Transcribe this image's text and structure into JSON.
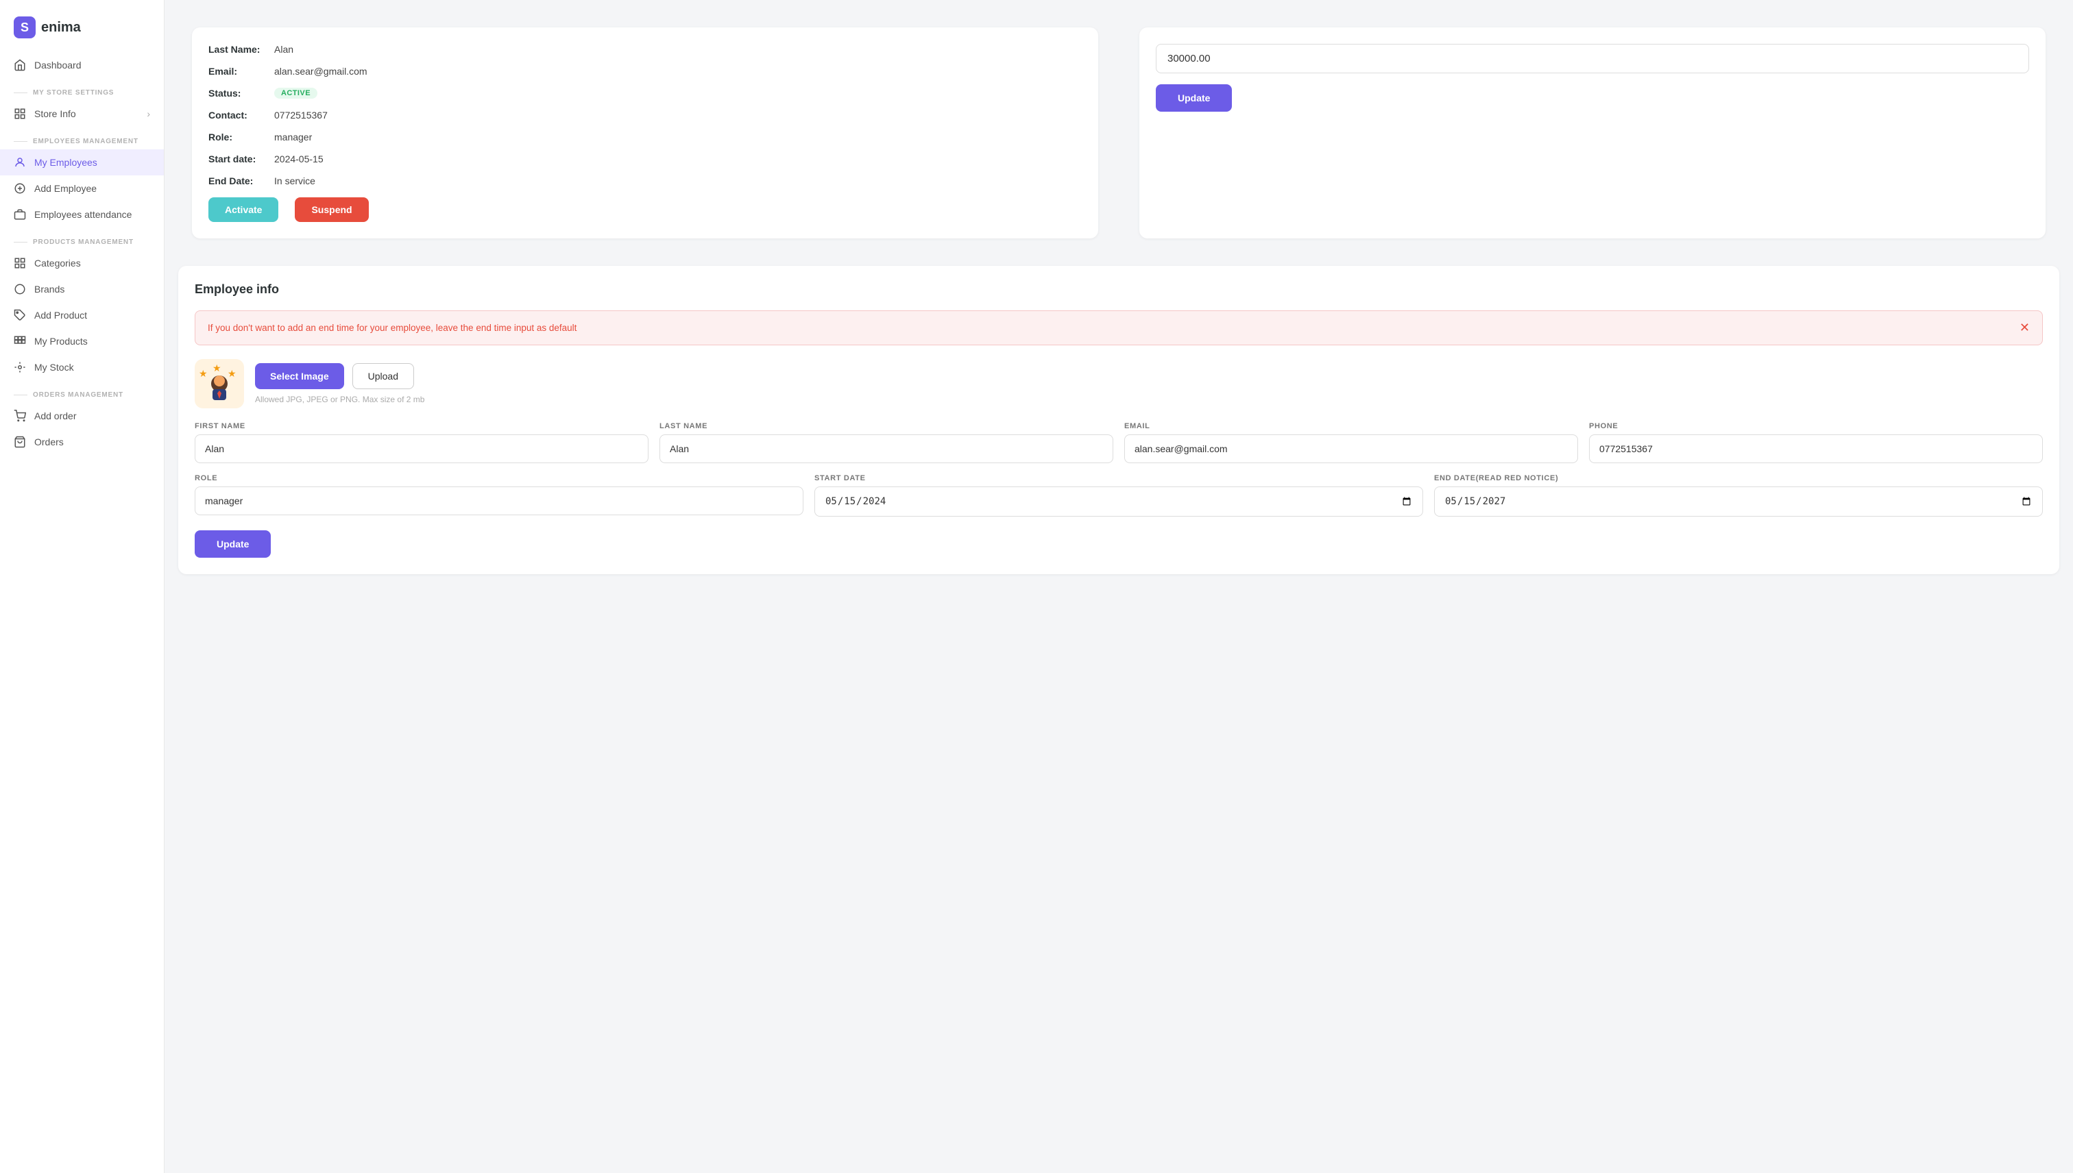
{
  "app": {
    "name": "enima",
    "logo_symbol": "S"
  },
  "sidebar": {
    "items": [
      {
        "id": "dashboard",
        "label": "Dashboard",
        "icon": "home-icon",
        "section": null
      },
      {
        "id": "store-info",
        "label": "Store Info",
        "icon": "store-icon",
        "section": "MY STORE SETTINGS",
        "has_arrow": true
      },
      {
        "id": "my-employees",
        "label": "My Employees",
        "icon": "person-icon",
        "section": "EMPLOYEES MANAGEMENT",
        "active": true
      },
      {
        "id": "add-employee",
        "label": "Add Employee",
        "icon": "add-circle-icon",
        "section": null
      },
      {
        "id": "employees-attendance",
        "label": "Employees attendance",
        "icon": "briefcase-icon",
        "section": null
      },
      {
        "id": "categories",
        "label": "Categories",
        "icon": "grid-icon",
        "section": "PRODUCTS MANAGEMENT"
      },
      {
        "id": "brands",
        "label": "Brands",
        "icon": "circle-icon",
        "section": null
      },
      {
        "id": "add-product",
        "label": "Add Product",
        "icon": "tag-icon",
        "section": null
      },
      {
        "id": "my-products",
        "label": "My Products",
        "icon": "products-icon",
        "section": null
      },
      {
        "id": "my-stock",
        "label": "My Stock",
        "icon": "stock-icon",
        "section": null
      },
      {
        "id": "add-order",
        "label": "Add order",
        "icon": "cart-icon",
        "section": "ORDERS MANAGEMENT"
      },
      {
        "id": "orders",
        "label": "Orders",
        "icon": "orders-icon",
        "section": null
      }
    ]
  },
  "employee_card": {
    "last_name_label": "Last Name:",
    "last_name_value": "Alan",
    "email_label": "Email:",
    "email_value": "alan.sear@gmail.com",
    "status_label": "Status:",
    "status_value": "ACTIVE",
    "contact_label": "Contact:",
    "contact_value": "0772515367",
    "role_label": "Role:",
    "role_value": "manager",
    "start_date_label": "Start date:",
    "start_date_value": "2024-05-15",
    "end_date_label": "End Date:",
    "end_date_value": "In service",
    "activate_label": "Activate",
    "suspend_label": "Suspend"
  },
  "salary_card": {
    "salary_value": "30000.00",
    "update_label": "Update"
  },
  "employee_form": {
    "section_title": "Employee info",
    "alert_message": "If you don't want to add an end time for your employee, leave the end time input as default",
    "select_image_label": "Select Image",
    "upload_label": "Upload",
    "image_hint": "Allowed JPG, JPEG or PNG. Max size of 2 mb",
    "fields": {
      "first_name_label": "FIRST NAME",
      "first_name_value": "Alan",
      "last_name_label": "LAST NAME",
      "last_name_value": "Alan",
      "email_label": "EMAIL",
      "email_value": "alan.sear@gmail.com",
      "phone_label": "PHONE",
      "phone_value": "0772515367",
      "role_label": "ROLE",
      "role_value": "manager",
      "start_date_label": "START DATE",
      "start_date_value": "15/05/2024",
      "end_date_label": "END DATE(READ RED NOTICE)",
      "end_date_value": "15/05/2027"
    },
    "update_label": "Update"
  }
}
